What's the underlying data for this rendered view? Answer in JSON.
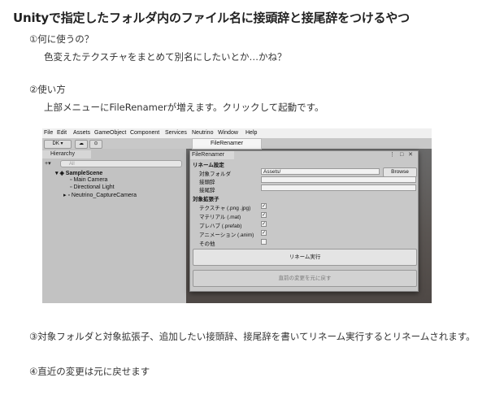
{
  "title": "Unityで指定したフォルダ内のファイル名に接頭辞と接尾辞をつけるやつ",
  "sections": [
    {
      "heading": "①何に使うの？",
      "body": "色変えたテクスチャをまとめて別名にしたいとか…かね？"
    },
    {
      "heading": "②使い方",
      "body": "上部メニューにFileRenamerが増えます。クリックして起動です。"
    },
    {
      "heading": "③対象フォルダと対象拡張子、追加したい接頭辞、接尾辞を書いてリネーム実行するとリネームされます。"
    },
    {
      "heading": "④直近の変更は元に戻せます"
    }
  ],
  "screenshot": {
    "menu": [
      "File",
      "Edit",
      "Assets",
      "GameObject",
      "Component",
      "Services",
      "Neutrino",
      "Window",
      "Help"
    ],
    "menu_popup_item": "FileRenamer",
    "toolbar": {
      "account": "DK ▾"
    },
    "hierarchy": {
      "tab": "Hierarchy",
      "search_placeholder": "All",
      "scene": "SampleScene",
      "items": [
        "Main Camera",
        "Directional Light",
        "Neutrino_CaptureCamera"
      ]
    },
    "window": {
      "tab": "FileRenamer",
      "section_rename": "リネーム設定",
      "target_folder_label": "対象フォルダ",
      "target_folder_value": "Assets/",
      "browse": "Browse",
      "prefix_label": "接頭辞",
      "suffix_label": "接尾辞",
      "section_ext": "対象拡張子",
      "extensions": [
        {
          "label": "テクスチャ (.png .jpg)",
          "checked": true
        },
        {
          "label": "マテリアル (.mat)",
          "checked": true
        },
        {
          "label": "プレハブ (.prefab)",
          "checked": true
        },
        {
          "label": "アニメーション (.anim)",
          "checked": true
        },
        {
          "label": "その他",
          "checked": false
        }
      ],
      "execute": "リネーム実行",
      "undo": "直前の変更を元に戻す"
    }
  }
}
